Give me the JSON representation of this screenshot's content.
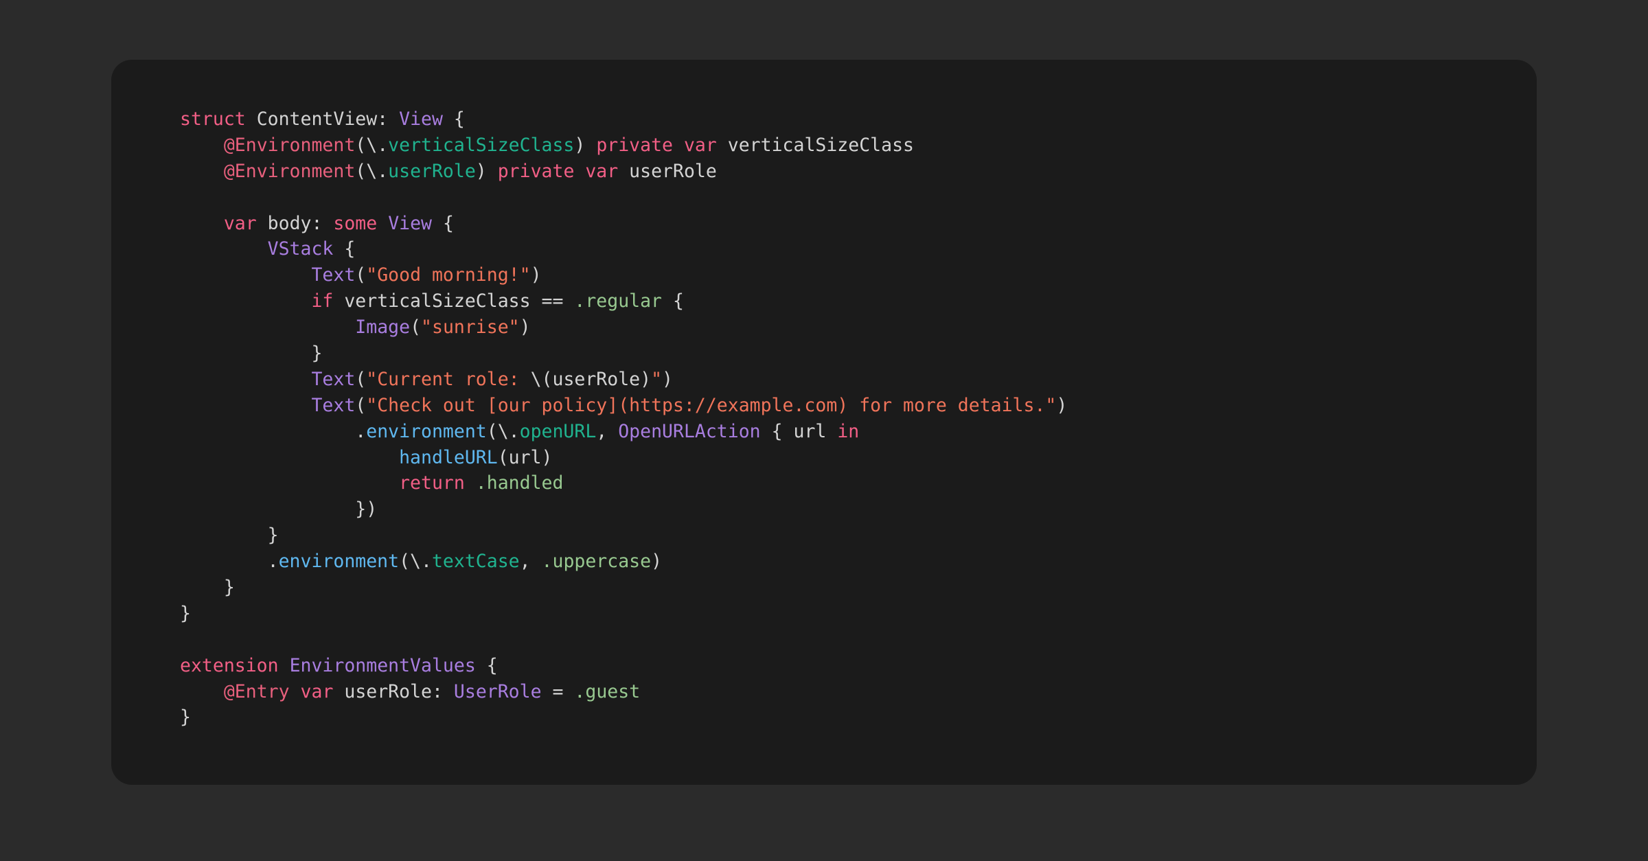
{
  "colors": {
    "background": "#2b2b2b",
    "card": "#1b1b1b",
    "plain": "#d4d4d4",
    "keyword": "#f25f86",
    "attribute": "#e8607d",
    "type": "#a97ee0",
    "property": "#20b38f",
    "string": "#f0745a",
    "function": "#5fb8f0",
    "enum_member": "#98c990"
  },
  "code": {
    "language": "swift",
    "lines": [
      [
        [
          "kw",
          "struct"
        ],
        [
          "plain",
          " ContentView: "
        ],
        [
          "type",
          "View"
        ],
        [
          "plain",
          " {"
        ]
      ],
      [
        [
          "plain",
          "    "
        ],
        [
          "attr",
          "@Environment"
        ],
        [
          "plain",
          "(\\."
        ],
        [
          "prop",
          "verticalSizeClass"
        ],
        [
          "plain",
          ") "
        ],
        [
          "kw",
          "private var"
        ],
        [
          "plain",
          " verticalSizeClass"
        ]
      ],
      [
        [
          "plain",
          "    "
        ],
        [
          "attr",
          "@Environment"
        ],
        [
          "plain",
          "(\\."
        ],
        [
          "prop",
          "userRole"
        ],
        [
          "plain",
          ") "
        ],
        [
          "kw",
          "private var"
        ],
        [
          "plain",
          " userRole"
        ]
      ],
      [],
      [
        [
          "plain",
          "    "
        ],
        [
          "kw",
          "var"
        ],
        [
          "plain",
          " body: "
        ],
        [
          "kw",
          "some"
        ],
        [
          "plain",
          " "
        ],
        [
          "type",
          "View"
        ],
        [
          "plain",
          " {"
        ]
      ],
      [
        [
          "plain",
          "        "
        ],
        [
          "type",
          "VStack"
        ],
        [
          "plain",
          " {"
        ]
      ],
      [
        [
          "plain",
          "            "
        ],
        [
          "type",
          "Text"
        ],
        [
          "plain",
          "("
        ],
        [
          "str",
          "\"Good morning!\""
        ],
        [
          "plain",
          ")"
        ]
      ],
      [
        [
          "plain",
          "            "
        ],
        [
          "kw",
          "if"
        ],
        [
          "plain",
          " verticalSizeClass == "
        ],
        [
          "enm",
          ".regular"
        ],
        [
          "plain",
          " {"
        ]
      ],
      [
        [
          "plain",
          "                "
        ],
        [
          "type",
          "Image"
        ],
        [
          "plain",
          "("
        ],
        [
          "str",
          "\"sunrise\""
        ],
        [
          "plain",
          ")"
        ]
      ],
      [
        [
          "plain",
          "            }"
        ]
      ],
      [
        [
          "plain",
          "            "
        ],
        [
          "type",
          "Text"
        ],
        [
          "plain",
          "("
        ],
        [
          "str",
          "\"Current role: "
        ],
        [
          "plain",
          "\\(userRole)"
        ],
        [
          "str",
          "\""
        ],
        [
          "plain",
          ")"
        ]
      ],
      [
        [
          "plain",
          "            "
        ],
        [
          "type",
          "Text"
        ],
        [
          "plain",
          "("
        ],
        [
          "str",
          "\"Check out [our policy](https://example.com) for more details.\""
        ],
        [
          "plain",
          ")"
        ]
      ],
      [
        [
          "plain",
          "                ."
        ],
        [
          "fn",
          "environment"
        ],
        [
          "plain",
          "(\\."
        ],
        [
          "prop",
          "openURL"
        ],
        [
          "plain",
          ", "
        ],
        [
          "type",
          "OpenURLAction"
        ],
        [
          "plain",
          " { url "
        ],
        [
          "kw",
          "in"
        ]
      ],
      [
        [
          "plain",
          "                    "
        ],
        [
          "fn",
          "handleURL"
        ],
        [
          "plain",
          "(url)"
        ]
      ],
      [
        [
          "plain",
          "                    "
        ],
        [
          "kw",
          "return"
        ],
        [
          "plain",
          " "
        ],
        [
          "enm",
          ".handled"
        ]
      ],
      [
        [
          "plain",
          "                })"
        ]
      ],
      [
        [
          "plain",
          "        }"
        ]
      ],
      [
        [
          "plain",
          "        ."
        ],
        [
          "fn",
          "environment"
        ],
        [
          "plain",
          "(\\."
        ],
        [
          "prop",
          "textCase"
        ],
        [
          "plain",
          ", "
        ],
        [
          "enm",
          ".uppercase"
        ],
        [
          "plain",
          ")"
        ]
      ],
      [
        [
          "plain",
          "    }"
        ]
      ],
      [
        [
          "plain",
          "}"
        ]
      ],
      [],
      [
        [
          "kw",
          "extension"
        ],
        [
          "plain",
          " "
        ],
        [
          "type",
          "EnvironmentValues"
        ],
        [
          "plain",
          " {"
        ]
      ],
      [
        [
          "plain",
          "    "
        ],
        [
          "attr",
          "@Entry"
        ],
        [
          "plain",
          " "
        ],
        [
          "kw",
          "var"
        ],
        [
          "plain",
          " userRole: "
        ],
        [
          "type",
          "UserRole"
        ],
        [
          "plain",
          " = "
        ],
        [
          "enm",
          ".guest"
        ]
      ],
      [
        [
          "plain",
          "}"
        ]
      ]
    ]
  }
}
